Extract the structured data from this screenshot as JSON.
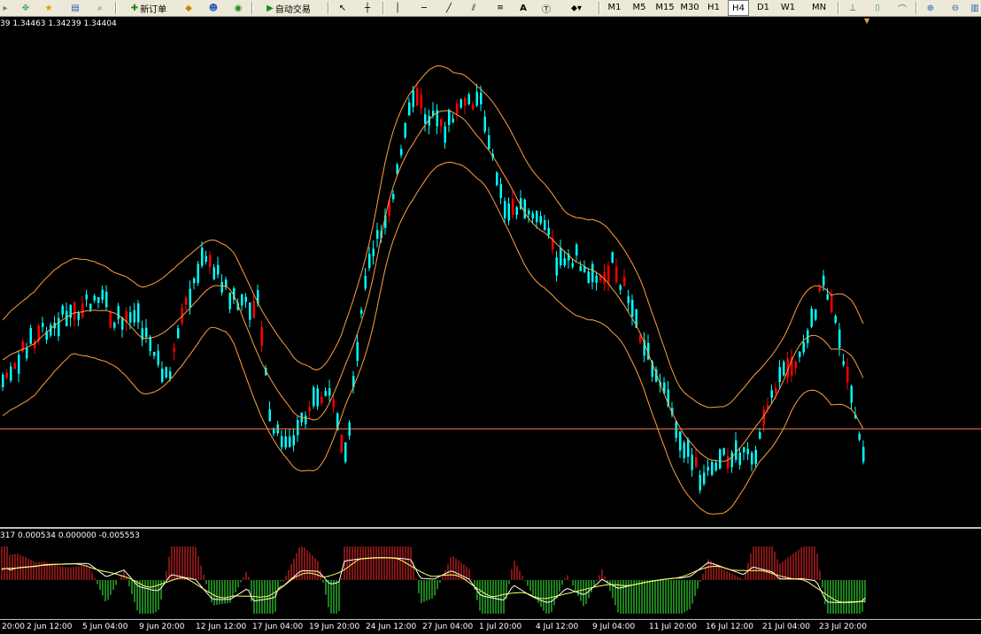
{
  "toolbar": {
    "new_order_label": "新订单",
    "autotrading_label": "自动交易",
    "tools": [
      "cursor",
      "crosshair",
      "vertical-line",
      "horizontal-line",
      "trendline",
      "equidistant-channel",
      "fibonacci",
      "text",
      "text-label",
      "arrows"
    ],
    "timeframes": [
      "M1",
      "M5",
      "M15",
      "M30",
      "H1",
      "H4",
      "D1",
      "W1",
      "MN"
    ],
    "active_timeframe": "H4"
  },
  "chart": {
    "ohlc_readout": "39 1.34463 1.34239 1.34404",
    "indicator_readout": "317 0.000534 0.000000 -0.005553",
    "current_price": 1.344,
    "colors": {
      "bull": "#ff0000",
      "bear": "#00ffff",
      "bands": "#ffa040",
      "midline": "#ffa040",
      "hist_pos": "#ff2a2a",
      "hist_neg": "#3cff3c",
      "line_main": "#ffffff",
      "line_signal": "#ffff60",
      "price_line": "#ff8040"
    }
  },
  "x_axis_labels": [
    "20:00",
    "2 Jun 12:00",
    "5 Jun 04:00",
    "9 Jun 20:00",
    "12 Jun 12:00",
    "17 Jun 04:00",
    "19 Jun 20:00",
    "24 Jun 12:00",
    "27 Jun 04:00",
    "1 Jul 20:00",
    "4 Jul 12:00",
    "9 Jul 04:00",
    "11 Jul 20:00",
    "16 Jul 12:00",
    "21 Jul 04:00",
    "23 Jul 20:00"
  ]
}
